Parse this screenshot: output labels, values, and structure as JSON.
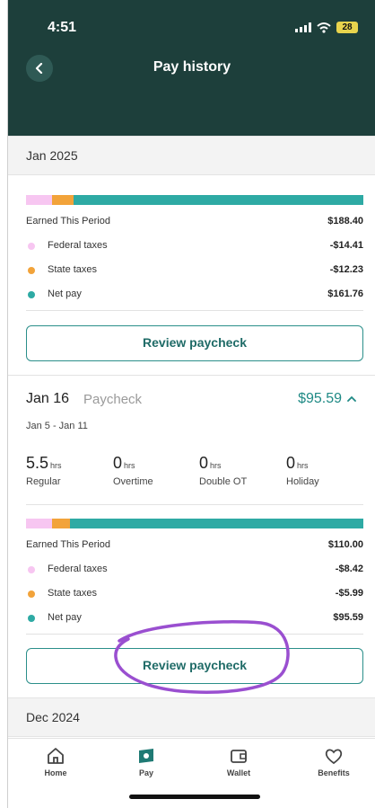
{
  "status_bar": {
    "time": "4:51",
    "battery": "28"
  },
  "header": {
    "title": "Pay history"
  },
  "colors": {
    "header_bg": "#1d3f3b",
    "accent": "#2eaaa4",
    "federal": "#f7c6f1",
    "state": "#f2a33a",
    "net": "#2eaaa4",
    "annotation": "#9a4fd0"
  },
  "jan_2025": {
    "label": "Jan 2025",
    "breakdown": {
      "earned_label": "Earned This Period",
      "earned_value": "$188.40",
      "federal_label": "Federal taxes",
      "federal_value": "-$14.41",
      "state_label": "State taxes",
      "state_value": "-$12.23",
      "net_label": "Net pay",
      "net_value": "$161.76",
      "bar_fractions": {
        "federal": 0.0765,
        "state": 0.0649,
        "net": 0.8586
      }
    },
    "review_label": "Review paycheck"
  },
  "paycheck": {
    "date": "Jan 16",
    "type": "Paycheck",
    "amount": "$95.59",
    "range": "Jan 5 - Jan 11",
    "hours": [
      {
        "value": "5.5",
        "unit": "hrs",
        "label": "Regular"
      },
      {
        "value": "0",
        "unit": "hrs",
        "label": "Overtime"
      },
      {
        "value": "0",
        "unit": "hrs",
        "label": "Double OT"
      },
      {
        "value": "0",
        "unit": "hrs",
        "label": "Holiday"
      }
    ],
    "breakdown": {
      "earned_label": "Earned This Period",
      "earned_value": "$110.00",
      "federal_label": "Federal taxes",
      "federal_value": "-$8.42",
      "state_label": "State taxes",
      "state_value": "-$5.99",
      "net_label": "Net pay",
      "net_value": "$95.59",
      "bar_fractions": {
        "federal": 0.0765,
        "state": 0.0545,
        "net": 0.869
      }
    },
    "review_label": "Review paycheck"
  },
  "dec_2024": {
    "label": "Dec 2024"
  },
  "nav": [
    {
      "label": "Home",
      "icon": "home-icon"
    },
    {
      "label": "Pay",
      "icon": "pay-icon"
    },
    {
      "label": "Wallet",
      "icon": "wallet-icon"
    },
    {
      "label": "Benefits",
      "icon": "heart-icon"
    }
  ]
}
